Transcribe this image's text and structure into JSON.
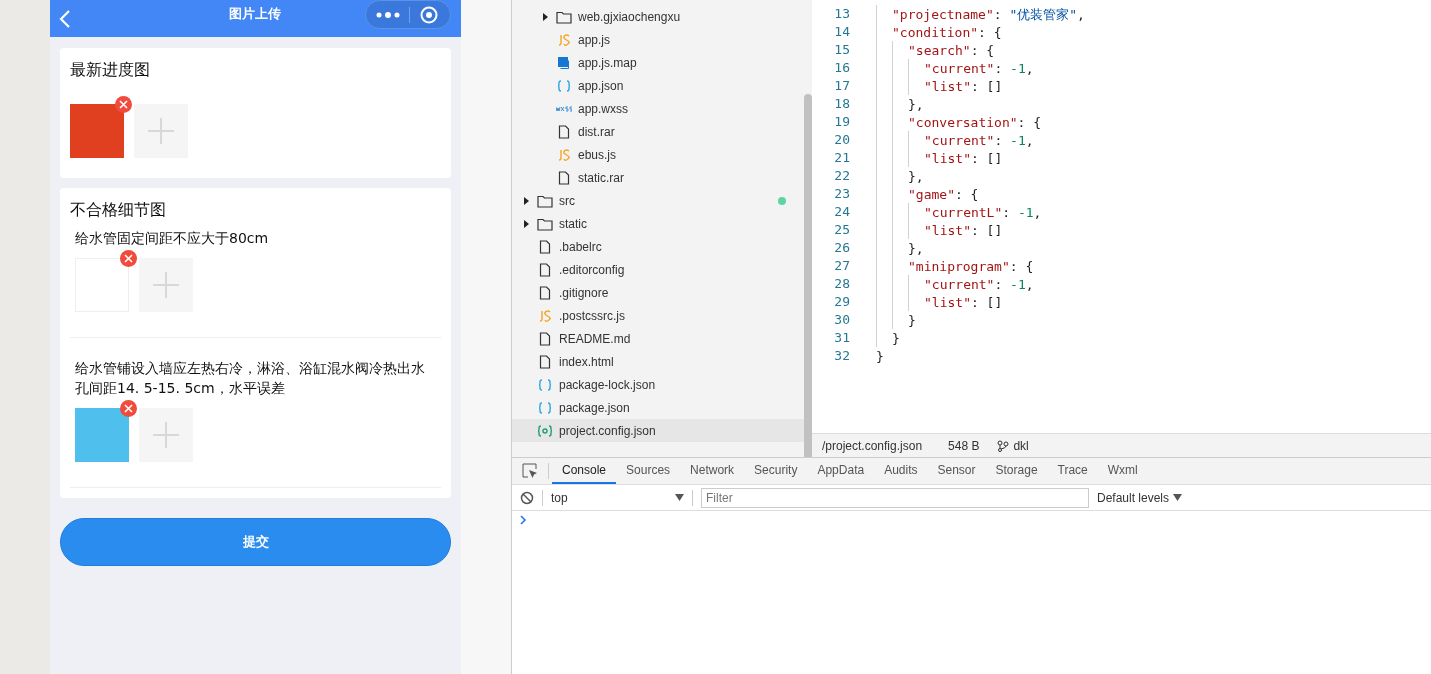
{
  "phone": {
    "title": "图片上传",
    "sections": [
      {
        "title": "最新进度图",
        "groups": [
          {
            "images": [
              {
                "kind": "photo"
              }
            ]
          }
        ]
      },
      {
        "title": "不合格细节图",
        "groups": [
          {
            "caption": "给水管固定间距不应大于80cm",
            "images": [
              {
                "kind": "sketch"
              }
            ]
          },
          {
            "caption": "给水管铺设入墙应左热右冷，淋浴、浴缸混水阀冷热出水孔间距14. 5-15. 5cm，水平误差",
            "images": [
              {
                "kind": "graphic"
              }
            ]
          }
        ]
      }
    ],
    "submit": "提交"
  },
  "tree_continued": [
    {
      "name": "web.gjxiaochengxu",
      "kind": "folder",
      "expanded": false,
      "selected": false,
      "modified": false
    },
    {
      "name": "app.js",
      "kind": "js",
      "selected": false,
      "modified": false
    },
    {
      "name": "app.js.map",
      "kind": "map",
      "selected": false,
      "modified": false
    },
    {
      "name": "app.json",
      "kind": "json",
      "selected": false,
      "modified": false
    },
    {
      "name": "app.wxss",
      "kind": "wxss",
      "selected": false,
      "modified": false
    },
    {
      "name": "dist.rar",
      "kind": "file",
      "selected": false,
      "modified": false
    },
    {
      "name": "ebus.js",
      "kind": "js",
      "selected": false,
      "modified": false
    },
    {
      "name": "static.rar",
      "kind": "file",
      "selected": false,
      "modified": false
    }
  ],
  "tree": [
    {
      "name": "src",
      "kind": "folder",
      "expanded": false,
      "selected": false,
      "modified": true
    },
    {
      "name": "static",
      "kind": "folder",
      "expanded": false,
      "selected": false,
      "modified": false
    },
    {
      "name": ".babelrc",
      "kind": "file",
      "selected": false,
      "modified": false
    },
    {
      "name": ".editorconfig",
      "kind": "file",
      "selected": false,
      "modified": false
    },
    {
      "name": ".gitignore",
      "kind": "file",
      "selected": false,
      "modified": false
    },
    {
      "name": ".postcssrc.js",
      "kind": "js",
      "selected": false,
      "modified": false
    },
    {
      "name": "README.md",
      "kind": "file",
      "selected": false,
      "modified": false
    },
    {
      "name": "index.html",
      "kind": "file",
      "selected": false,
      "modified": false
    },
    {
      "name": "package-lock.json",
      "kind": "json",
      "selected": false,
      "modified": false
    },
    {
      "name": "package.json",
      "kind": "json",
      "selected": false,
      "modified": false
    },
    {
      "name": "project.config.json",
      "kind": "config",
      "selected": true,
      "modified": false
    }
  ],
  "editor": {
    "lines": [
      {
        "n": "13",
        "code": "  \"projectname\": \"优装管家\","
      },
      {
        "n": "14",
        "code": "  \"condition\": {"
      },
      {
        "n": "15",
        "code": "    \"search\": {"
      },
      {
        "n": "16",
        "code": "      \"current\": -1,"
      },
      {
        "n": "17",
        "code": "      \"list\": []"
      },
      {
        "n": "18",
        "code": "    },"
      },
      {
        "n": "19",
        "code": "    \"conversation\": {"
      },
      {
        "n": "20",
        "code": "      \"current\": -1,"
      },
      {
        "n": "21",
        "code": "      \"list\": []"
      },
      {
        "n": "22",
        "code": "    },"
      },
      {
        "n": "23",
        "code": "    \"game\": {"
      },
      {
        "n": "24",
        "code": "      \"currentL\": -1,"
      },
      {
        "n": "25",
        "code": "      \"list\": []"
      },
      {
        "n": "26",
        "code": "    },"
      },
      {
        "n": "27",
        "code": "    \"miniprogram\": {"
      },
      {
        "n": "28",
        "code": "      \"current\": -1,"
      },
      {
        "n": "29",
        "code": "      \"list\": []"
      },
      {
        "n": "30",
        "code": "    }"
      },
      {
        "n": "31",
        "code": "  }"
      },
      {
        "n": "32",
        "code": "}"
      }
    ],
    "status": {
      "path": "/project.config.json",
      "size": "548 B",
      "branch": "dkl"
    }
  },
  "devtools": {
    "tabs": [
      {
        "label": "Console",
        "selected": true
      },
      {
        "label": "Sources",
        "selected": false
      },
      {
        "label": "Network",
        "selected": false
      },
      {
        "label": "Security",
        "selected": false
      },
      {
        "label": "AppData",
        "selected": false
      },
      {
        "label": "Audits",
        "selected": false
      },
      {
        "label": "Sensor",
        "selected": false
      },
      {
        "label": "Storage",
        "selected": false
      },
      {
        "label": "Trace",
        "selected": false
      },
      {
        "label": "Wxml",
        "selected": false
      }
    ],
    "context": "top",
    "filter_placeholder": "Filter",
    "levels": "Default levels"
  }
}
